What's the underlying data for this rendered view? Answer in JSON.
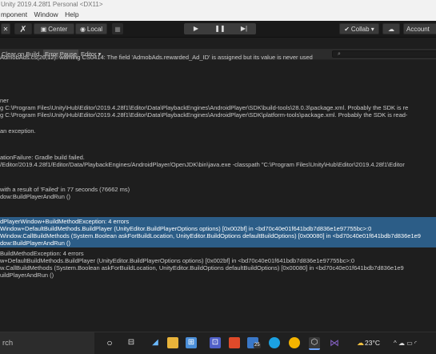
{
  "window": {
    "title": "Unity 2019.4.28f1 Personal <DX11>"
  },
  "menu": [
    "mponent",
    "Window",
    "Help"
  ],
  "toolbar": {
    "center_label": "Center",
    "local_label": "Local",
    "collab_label": "Collab ▾",
    "account_label": "Account"
  },
  "console": {
    "clear_on_build": "Clear on Build",
    "error_pause": "Error Pause",
    "editor_dropdown": "Editor ▾",
    "search_placeholder": ""
  },
  "log": [
    {
      "lines": [
        "AdmobAds.cs(20,12): warning CS0414: The field 'AdmobAds.rewarded_Ad_ID' is assigned but its value is never used"
      ],
      "selected": false
    },
    {
      "lines": [
        "ner",
        "g C:\\Program Files\\Unity\\Hub\\Editor\\2019.4.28f1\\Editor\\Data\\PlaybackEngines\\AndroidPlayer\\SDK\\build-tools\\28.0.3\\package.xml. Probably the SDK is re",
        "g C:\\Program Files\\Unity\\Hub\\Editor\\2019.4.28f1\\Editor\\Data\\PlaybackEngines\\AndroidPlayer\\SDK\\platform-tools\\package.xml. Probably the SDK is read-"
      ],
      "selected": false
    },
    {
      "lines": [
        "an exception."
      ],
      "selected": false
    },
    {
      "lines": [
        "ationFailure: Gradle build failed.",
        "/Editor/2019.4.28f1/Editor/Data/PlaybackEngines/AndroidPlayer/OpenJDK\\bin\\java.exe -classpath \"C:\\Program Files\\Unity\\Hub\\Editor\\2019.4.28f1\\Editor"
      ],
      "selected": false
    },
    {
      "lines": [
        "with a result of 'Failed' in 77 seconds (76662 ms)",
        "dow:BuildPlayerAndRun ()"
      ],
      "selected": false
    },
    {
      "lines": [
        "dPlayerWindow+BuildMethodException: 4 errors",
        "Window+DefaultBuildMethods.BuildPlayer (UnityEditor.BuildPlayerOptions options) [0x002bf] in <bd70c40e01f641bdb7d836e1e97755bc>:0",
        "Window.CallBuildMethods (System.Boolean askForBuildLocation, UnityEditor.BuildOptions defaultBuildOptions) [0x00080] in <bd70c40e01f641bdb7d836e1e9",
        "dow:BuildPlayerAndRun ()"
      ],
      "selected": true
    },
    {
      "lines": [
        "BuildMethodException: 4 errors",
        "w+DefaultBuildMethods.BuildPlayer (UnityEditor.BuildPlayerOptions options) [0x002bf] in <bd70c40e01f641bdb7d836e1e97755bc>:0",
        "w.CallBuildMethods (System.Boolean askForBuildLocation, UnityEditor.BuildOptions defaultBuildOptions) [0x00080] in <bd70c40e01f641bdb7d836e1e9",
        "uildPlayerAndRun ()"
      ],
      "selected": false
    }
  ],
  "taskbar": {
    "search_label": "rch",
    "badge_count": "25",
    "temperature": "23°C",
    "icons": [
      "start-circle-icon",
      "task-view-icon",
      "app-icon",
      "file-explorer-icon",
      "store-icon",
      "teams-icon",
      "office-icon",
      "weather-app-icon",
      "edge-icon",
      "chrome-icon",
      "unity-icon",
      "visual-studio-icon"
    ]
  },
  "colors": {
    "selection": "#2c5d87",
    "visual_studio": "#8661c5",
    "chrome": "#f4b400",
    "edge": "#1ba1e2"
  }
}
